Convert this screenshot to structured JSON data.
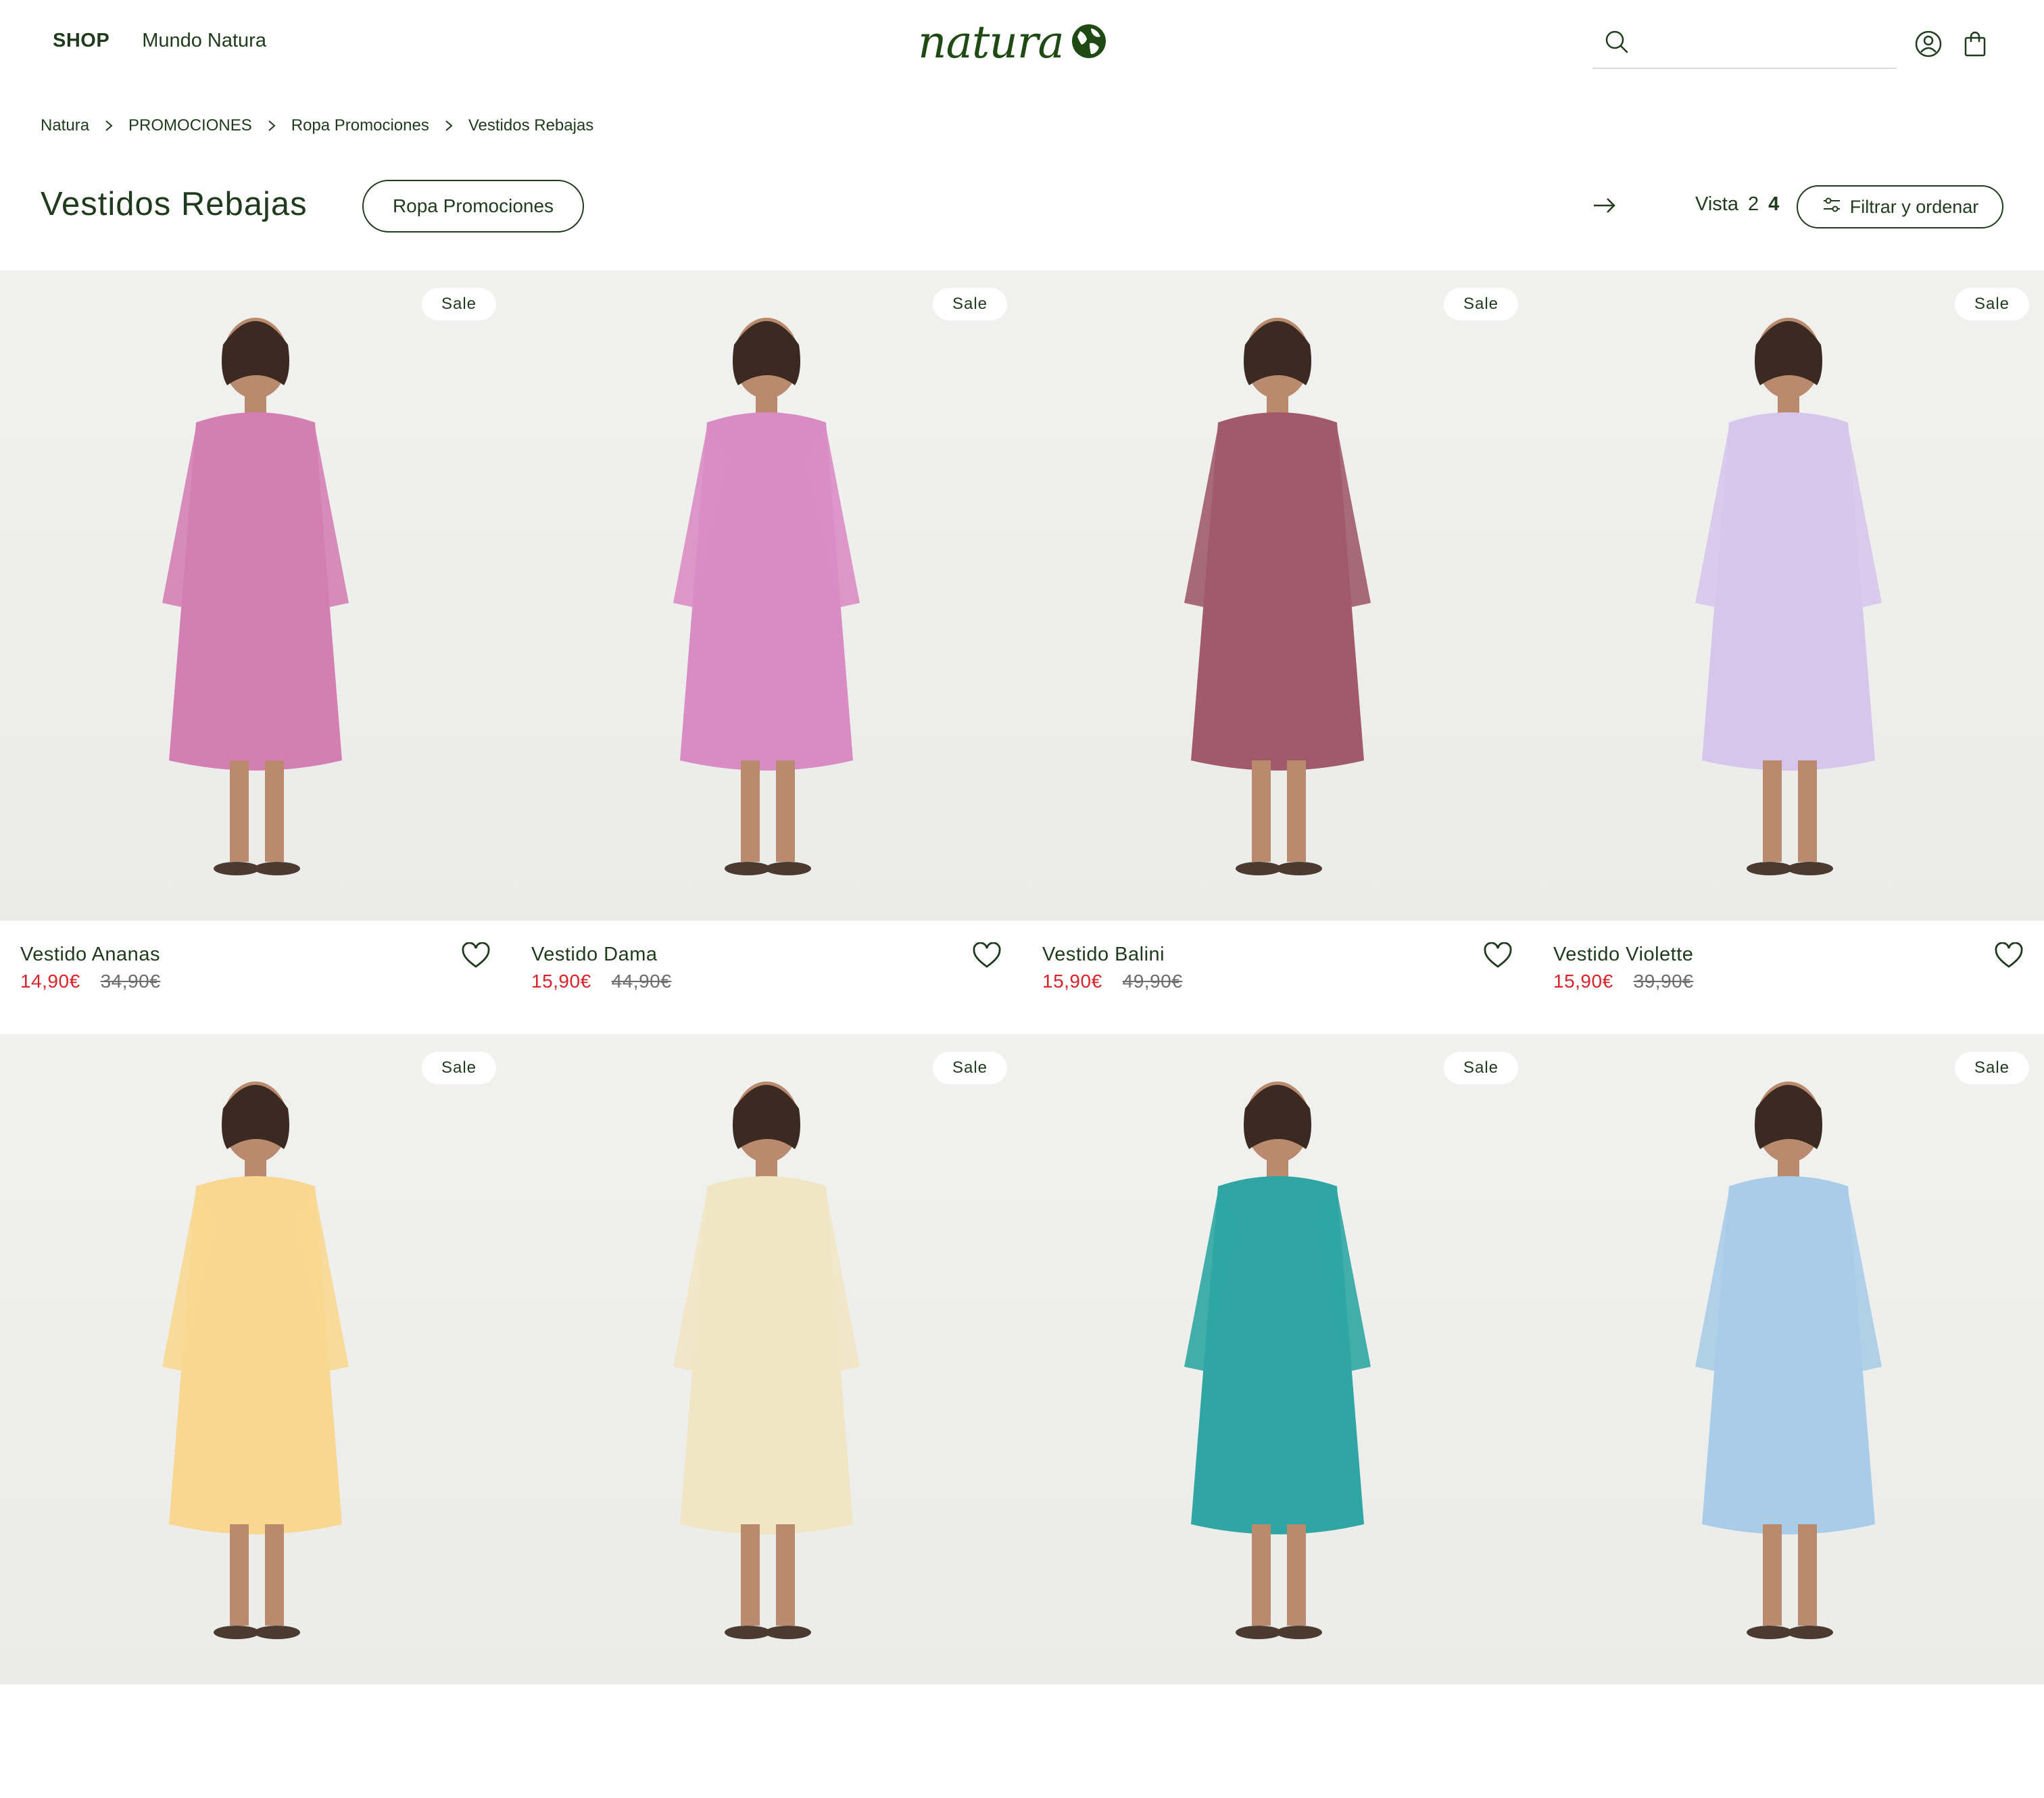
{
  "header": {
    "nav": {
      "shop": "SHOP",
      "mundo": "Mundo Natura"
    },
    "logo_text": "natura",
    "search": {
      "value": "",
      "placeholder": ""
    }
  },
  "breadcrumb": [
    "Natura",
    "PROMOCIONES",
    "Ropa Promociones",
    "Vestidos Rebajas"
  ],
  "page": {
    "title": "Vestidos Rebajas",
    "category_pill": "Ropa Promociones",
    "view_label": "Vista",
    "view_options": [
      "2",
      "4"
    ],
    "view_selected": "4",
    "filter_label": "Filtrar y ordenar"
  },
  "products": [
    {
      "badge": "Sale",
      "name": "Vestido Ananas",
      "price": "14,90€",
      "old_price": "34,90€",
      "dress_color": "#d47fb4"
    },
    {
      "badge": "Sale",
      "name": "Vestido Dama",
      "price": "15,90€",
      "old_price": "44,90€",
      "dress_color": "#d98cc4"
    },
    {
      "badge": "Sale",
      "name": "Vestido Balini",
      "price": "15,90€",
      "old_price": "49,90€",
      "dress_color": "#a05a6a"
    },
    {
      "badge": "Sale",
      "name": "Vestido Violette",
      "price": "15,90€",
      "old_price": "39,90€",
      "dress_color": "#d7c6ec"
    },
    {
      "badge": "Sale",
      "name": "",
      "price": "",
      "old_price": "",
      "dress_color": "#f8d890"
    },
    {
      "badge": "Sale",
      "name": "",
      "price": "",
      "old_price": "",
      "dress_color": "#f1e6c4"
    },
    {
      "badge": "Sale",
      "name": "",
      "price": "",
      "old_price": "",
      "dress_color": "#2fa6a3"
    },
    {
      "badge": "Sale",
      "name": "",
      "price": "",
      "old_price": "",
      "dress_color": "#a9cce8"
    }
  ],
  "colors": {
    "brand_green": "#1f3a1c",
    "sale_red": "#d8232a"
  }
}
